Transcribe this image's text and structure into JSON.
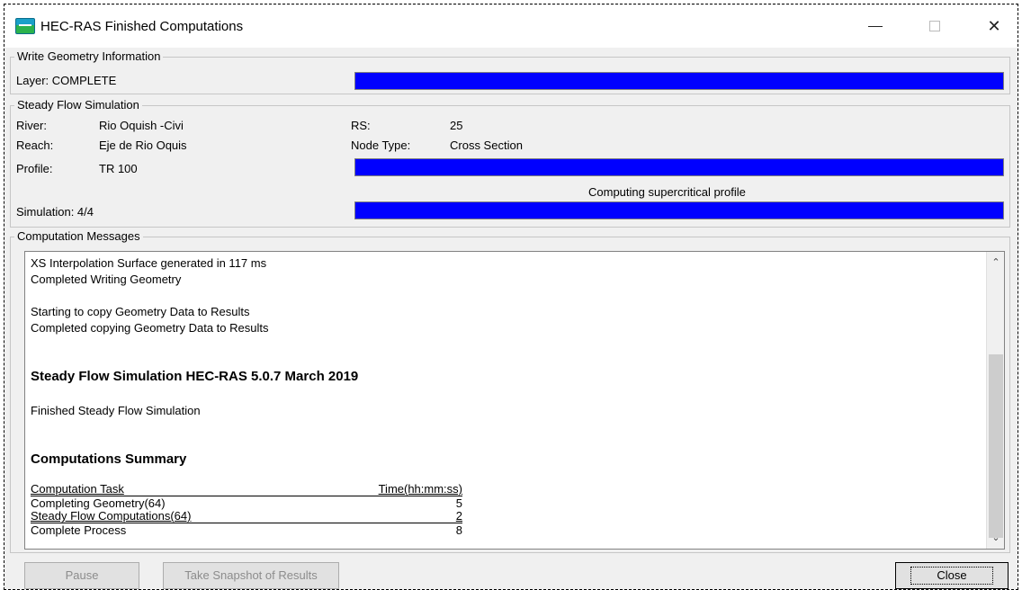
{
  "window": {
    "title": "HEC-RAS Finished Computations",
    "minimize_icon": "minimize-icon",
    "maximize_icon": "maximize-icon",
    "close_glyph": "✕"
  },
  "geometry_group": {
    "legend": "Write Geometry Information",
    "layer_label": "Layer:  COMPLETE",
    "progress": 1.0
  },
  "steady_group": {
    "legend": "Steady Flow Simulation",
    "river_label": "River:",
    "river_value": "Rio Oquish -Civi",
    "reach_label": "Reach:",
    "reach_value": "Eje de Rio Oquis",
    "profile_label": "Profile:",
    "profile_value": "TR 100",
    "rs_label": "RS:",
    "rs_value": "25",
    "node_type_label": "Node Type:",
    "node_type_value": "Cross Section",
    "profile_progress": 1.0,
    "status_text": "Computing supercritical profile",
    "simulation_label": "Simulation:  4/4",
    "simulation_progress": 1.0
  },
  "messages_group": {
    "legend": "Computation Messages",
    "lines": [
      "XS Interpolation Surface generated in 117 ms",
      "Completed Writing Geometry",
      "",
      "Starting to copy Geometry Data to Results",
      "Completed copying Geometry Data to Results"
    ],
    "heading": "Steady Flow Simulation HEC-RAS 5.0.7 March 2019",
    "finished": "Finished Steady Flow Simulation",
    "summary_heading": "Computations Summary",
    "summary": {
      "header": [
        "Computation Task",
        "Time(hh:mm:ss)"
      ],
      "rows": [
        [
          "Completing Geometry(64)",
          "5"
        ],
        [
          "Steady Flow Computations(64)",
          "2"
        ],
        [
          "Complete Process",
          "8"
        ]
      ]
    }
  },
  "buttons": {
    "pause": "Pause",
    "snapshot": "Take Snapshot of Results",
    "close": "Close"
  },
  "colors": {
    "progress_fill": "#0000ff",
    "dialog_bg": "#f0f0f0"
  }
}
